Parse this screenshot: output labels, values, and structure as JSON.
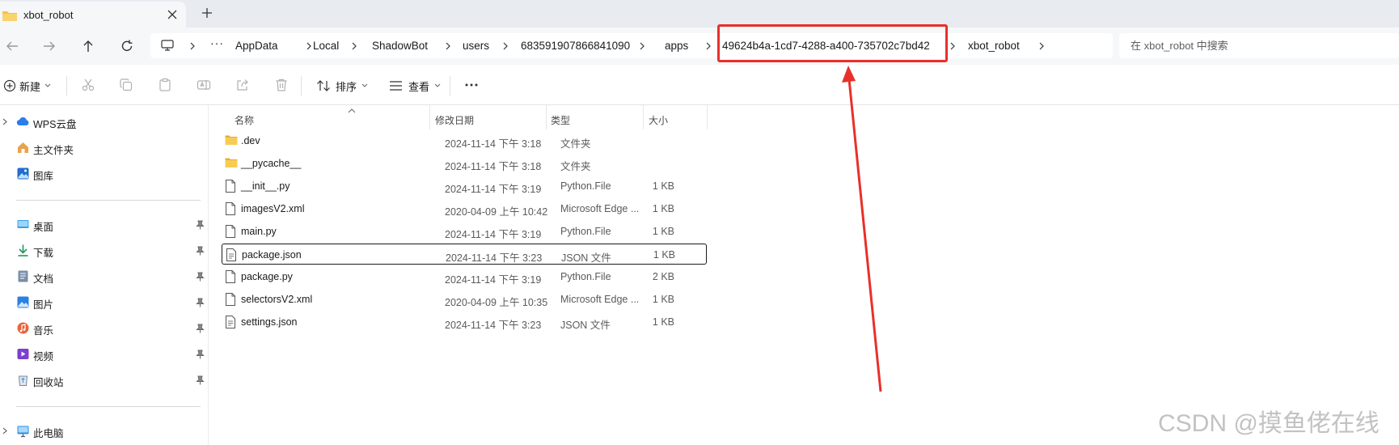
{
  "tab": {
    "title": "xbot_robot"
  },
  "breadcrumb": [
    "AppData",
    "Local",
    "ShadowBot",
    "users",
    "683591907866841090",
    "apps",
    "49624b4a-1cd7-4288-a400-735702c7bd42",
    "xbot_robot"
  ],
  "search": {
    "placeholder": "在 xbot_robot 中搜索"
  },
  "toolbar": {
    "new_label": "新建",
    "sort_label": "排序",
    "view_label": "查看"
  },
  "sidebar": {
    "top": [
      {
        "label": "WPS云盘",
        "icon": "cloud-icon"
      },
      {
        "label": "主文件夹",
        "icon": "home-icon"
      },
      {
        "label": "图库",
        "icon": "gallery-icon"
      }
    ],
    "pinned": [
      {
        "label": "桌面",
        "icon": "desktop-icon"
      },
      {
        "label": "下载",
        "icon": "download-icon"
      },
      {
        "label": "文档",
        "icon": "documents-icon"
      },
      {
        "label": "图片",
        "icon": "pictures-icon"
      },
      {
        "label": "音乐",
        "icon": "music-icon"
      },
      {
        "label": "视频",
        "icon": "videos-icon"
      },
      {
        "label": "回收站",
        "icon": "recycle-bin-icon"
      }
    ],
    "bottom": [
      {
        "label": "此电脑",
        "icon": "this-pc-icon"
      }
    ]
  },
  "columns": {
    "name": "名称",
    "date": "修改日期",
    "type": "类型",
    "size": "大小"
  },
  "files": [
    {
      "name": ".dev",
      "date": "2024-11-14 下午 3:18",
      "type": "文件夹",
      "size": "",
      "kind": "folder"
    },
    {
      "name": "__pycache__",
      "date": "2024-11-14 下午 3:18",
      "type": "文件夹",
      "size": "",
      "kind": "folder"
    },
    {
      "name": "__init__.py",
      "date": "2024-11-14 下午 3:19",
      "type": "Python.File",
      "size": "1 KB",
      "kind": "file"
    },
    {
      "name": "imagesV2.xml",
      "date": "2020-04-09 上午 10:42",
      "type": "Microsoft Edge ...",
      "size": "1 KB",
      "kind": "file"
    },
    {
      "name": "main.py",
      "date": "2024-11-14 下午 3:19",
      "type": "Python.File",
      "size": "1 KB",
      "kind": "file"
    },
    {
      "name": "package.json",
      "date": "2024-11-14 下午 3:23",
      "type": "JSON 文件",
      "size": "1 KB",
      "kind": "json",
      "selected": true
    },
    {
      "name": "package.py",
      "date": "2024-11-14 下午 3:19",
      "type": "Python.File",
      "size": "2 KB",
      "kind": "file"
    },
    {
      "name": "selectorsV2.xml",
      "date": "2020-04-09 上午 10:35",
      "type": "Microsoft Edge ...",
      "size": "1 KB",
      "kind": "file"
    },
    {
      "name": "settings.json",
      "date": "2024-11-14 下午 3:23",
      "type": "JSON 文件",
      "size": "1 KB",
      "kind": "json"
    }
  ],
  "watermark": "CSDN @摸鱼佬在线",
  "colors": {
    "highlight": "#e8302a",
    "folder": "#f4c24c",
    "accent": "#0067c0"
  }
}
